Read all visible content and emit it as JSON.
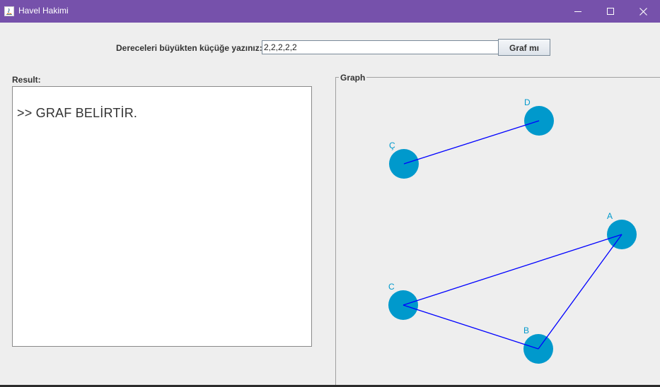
{
  "window": {
    "title": "Havel Hakimi",
    "titlebar_color": "#7651ab"
  },
  "controls": {
    "prompt_label": "Dereceleri büyükten küçüğe yazınız:",
    "degree_value": "2,2,2,2,2",
    "submit_label": "Graf mı"
  },
  "result": {
    "label": "Result:",
    "output": ">> GRAF BELİRTİR."
  },
  "graph": {
    "label": "Graph",
    "node_color": "#0099cc",
    "edge_color": "#0000ff",
    "nodes": [
      {
        "id": "A",
        "label": "A"
      },
      {
        "id": "B",
        "label": "B"
      },
      {
        "id": "C",
        "label": "C"
      },
      {
        "id": "Ç",
        "label": "Ç"
      },
      {
        "id": "D",
        "label": "D"
      }
    ],
    "edges": [
      [
        "A",
        "B"
      ],
      [
        "B",
        "C"
      ],
      [
        "C",
        "A"
      ],
      [
        "Ç",
        "D"
      ]
    ]
  }
}
